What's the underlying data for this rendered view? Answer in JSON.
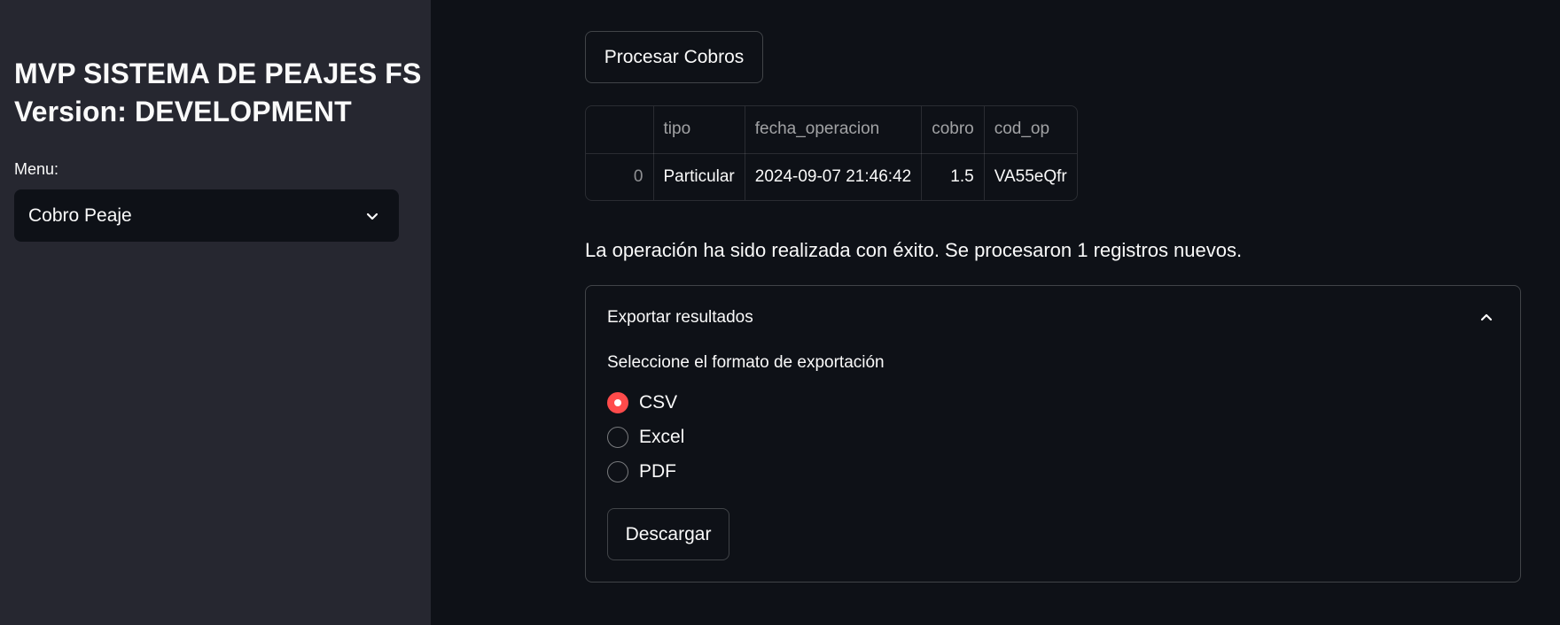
{
  "sidebar": {
    "title_line1": "MVP SISTEMA DE PEAJES FS",
    "title_line2": "Version: DEVELOPMENT",
    "menu_label": "Menu:",
    "menu_selected": "Cobro Peaje",
    "menu_icon": "chevron-down-icon"
  },
  "main": {
    "process_button": "Procesar Cobros",
    "table": {
      "columns": [
        "",
        "tipo",
        "fecha_operacion",
        "cobro",
        "cod_op"
      ],
      "rows": [
        {
          "index": "0",
          "tipo": "Particular",
          "fecha_operacion": "2024-09-07 21:46:42",
          "cobro": "1.5",
          "cod_op": "VA55eQfr"
        }
      ]
    },
    "success_message": "La operación ha sido realizada con éxito. Se procesaron 1 registros nuevos.",
    "expander": {
      "title": "Exportar resultados",
      "toggle_icon": "chevron-up-icon",
      "radio_label": "Seleccione el formato de exportación",
      "options": [
        "CSV",
        "Excel",
        "PDF"
      ],
      "selected": "CSV",
      "download_button": "Descargar"
    }
  },
  "colors": {
    "background": "#0e1117",
    "sidebar_bg": "#262730",
    "accent": "#ff4b4b",
    "text": "#fafafa"
  }
}
